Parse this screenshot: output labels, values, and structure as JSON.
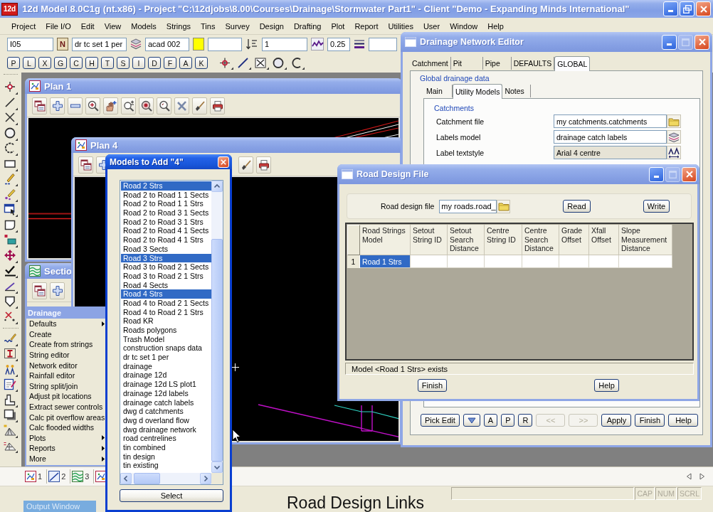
{
  "window": {
    "icon_label": "12d",
    "title": "12d Model 8.0C1g (nt.x86) - Project \"C:\\12djobs\\8.00\\Courses\\Drainage\\Stormwater Part1\" - Client \"Demo - Expanding Minds International\""
  },
  "menu_bar": [
    "Project",
    "File I/O",
    "Edit",
    "View",
    "Models",
    "Strings",
    "Tins",
    "Survey",
    "Design",
    "Drafting",
    "Plot",
    "Report",
    "Utilities",
    "User",
    "Window",
    "Help"
  ],
  "toolbar": [
    {
      "kind": "field",
      "value": "I05"
    },
    {
      "kind": "letter",
      "label": "N"
    },
    {
      "kind": "field",
      "value": "dr tc set 1 per"
    },
    {
      "kind": "icon"
    },
    {
      "kind": "field",
      "value": "acad 002"
    },
    {
      "kind": "swatch",
      "color": "#ffff00"
    },
    {
      "kind": "field"
    },
    {
      "kind": "icon"
    },
    {
      "kind": "field",
      "value": "1"
    },
    {
      "kind": "icon"
    },
    {
      "kind": "field",
      "value": "0.25"
    },
    {
      "kind": "icon"
    },
    {
      "kind": "field"
    }
  ],
  "snap_buttons": [
    "P",
    "L",
    "X",
    "G",
    "C",
    "H",
    "T",
    "S",
    "I",
    "D",
    "F",
    "A",
    "K"
  ],
  "network_editor": {
    "title": "Drainage Network Editor",
    "maximize_enabled": false,
    "tabs": [
      {
        "label": "Catchment",
        "selected": false
      },
      {
        "label": "Pit",
        "selected": false
      },
      {
        "label": "Pipe",
        "selected": false
      },
      {
        "label": "DEFAULTS",
        "selected": false
      },
      {
        "label": "GLOBAL",
        "selected": true
      }
    ],
    "group_title": "Global drainage data",
    "subtabs": [
      {
        "label": "Main",
        "selected": false
      },
      {
        "label": "Utility Models",
        "selected": true
      },
      {
        "label": "Notes",
        "selected": false
      }
    ],
    "section_title": "Catchments",
    "rows": [
      {
        "label": "Catchment file",
        "value": "my catchments.catchments",
        "kind": "file",
        "readonly": false
      },
      {
        "label": "Labels model",
        "value": "drainage catch labels",
        "kind": "model",
        "readonly": false
      },
      {
        "label": "Label textstyle",
        "value": "Arial 4 centre",
        "kind": "textstyle",
        "readonly": true
      }
    ],
    "buttons": [
      {
        "kind": "text",
        "label": "Pick Edit",
        "disabled": false
      },
      {
        "kind": "menu"
      },
      {
        "kind": "text",
        "label": "A",
        "disabled": false
      },
      {
        "kind": "text",
        "label": "P",
        "disabled": false
      },
      {
        "kind": "text",
        "label": "R",
        "disabled": false
      },
      {
        "kind": "text",
        "label": "<<",
        "disabled": true
      },
      {
        "kind": "text",
        "label": ">>",
        "disabled": true
      },
      {
        "kind": "text",
        "label": "Apply",
        "disabled": false
      },
      {
        "kind": "text",
        "label": "Finish",
        "disabled": false
      },
      {
        "kind": "text",
        "label": "Help",
        "disabled": false
      }
    ]
  },
  "views": [
    {
      "title": "Plan 1",
      "kind": "plan"
    },
    {
      "title": "Plan 4",
      "kind": "plan"
    },
    {
      "title": "Sectio",
      "kind": "section"
    }
  ],
  "models_dialog": {
    "title": "Models to Add \"4\"",
    "items": [
      {
        "label": "Road 2 Strs",
        "selected": true
      },
      {
        "label": "Road 2 to Road 1 1 Sects",
        "selected": false
      },
      {
        "label": "Road 2 to Road 1 1 Strs",
        "selected": false
      },
      {
        "label": "Road 2 to Road 3 1 Sects",
        "selected": false
      },
      {
        "label": "Road 2 to Road 3 1 Strs",
        "selected": false
      },
      {
        "label": "Road 2 to Road 4 1 Sects",
        "selected": false
      },
      {
        "label": "Road 2 to Road 4 1 Strs",
        "selected": false
      },
      {
        "label": "Road 3 Sects",
        "selected": false
      },
      {
        "label": "Road 3 Strs",
        "selected": true
      },
      {
        "label": "Road 3 to Road 2 1 Sects",
        "selected": false
      },
      {
        "label": "Road 3 to Road 2 1 Strs",
        "selected": false
      },
      {
        "label": "Road 4 Sects",
        "selected": false
      },
      {
        "label": "Road 4 Strs",
        "selected": true
      },
      {
        "label": "Road 4 to Road 2 1 Sects",
        "selected": false
      },
      {
        "label": "Road 4 to Road 2 1 Strs",
        "selected": false
      },
      {
        "label": "Road KR",
        "selected": false
      },
      {
        "label": "Roads polygons",
        "selected": false
      },
      {
        "label": "Trash Model",
        "selected": false
      },
      {
        "label": "construction snaps data",
        "selected": false
      },
      {
        "label": "dr tc set 1 per",
        "selected": false
      },
      {
        "label": "drainage",
        "selected": false
      },
      {
        "label": "drainage 12d",
        "selected": false
      },
      {
        "label": "drainage 12d LS plot1",
        "selected": false
      },
      {
        "label": "drainage 12d labels",
        "selected": false
      },
      {
        "label": "drainage catch labels",
        "selected": false
      },
      {
        "label": "dwg d catchments",
        "selected": false
      },
      {
        "label": "dwg d overland flow",
        "selected": false
      },
      {
        "label": "dwg drainage network",
        "selected": false
      },
      {
        "label": "road centrelines",
        "selected": false
      },
      {
        "label": "tin combined",
        "selected": false
      },
      {
        "label": "tin design",
        "selected": false
      },
      {
        "label": "tin existing",
        "selected": false
      }
    ],
    "button": "Select"
  },
  "road_design": {
    "title": "Road Design File",
    "maximize_enabled": false,
    "file_label": "Road design file",
    "file_value": "my roads.road_",
    "actions": [
      "Read",
      "Write"
    ],
    "columns": [
      "Road Strings Model",
      "Setout String ID",
      "Setout Search Distance",
      "Centre String ID",
      "Centre Search Distance",
      "Grade Offset",
      "Xfall Offset",
      "Slope Measurement Distance"
    ],
    "rows": [
      {
        "number": "1",
        "model": "Road 1 Strs",
        "selected": true
      }
    ],
    "message": "Model <Road 1 Strs> exists",
    "buttons": [
      "Finish",
      "Help"
    ]
  },
  "drainage_menu": {
    "title": "Drainage",
    "items": [
      {
        "label": "Defaults",
        "submenu": true
      },
      {
        "label": "Create",
        "submenu": false
      },
      {
        "label": "Create from strings",
        "submenu": false
      },
      {
        "label": "String editor",
        "submenu": false
      },
      {
        "label": "Network editor",
        "submenu": false
      },
      {
        "label": "Rainfall editor",
        "submenu": false
      },
      {
        "label": "String split/join",
        "submenu": false
      },
      {
        "label": "Adjust pit locations",
        "submenu": false
      },
      {
        "label": "Extract sewer controls",
        "submenu": false
      },
      {
        "label": "Calc pit overflow areas",
        "submenu": false
      },
      {
        "label": "Calc flooded widths",
        "submenu": false
      },
      {
        "label": "Plots",
        "submenu": true
      },
      {
        "label": "Reports",
        "submenu": true
      },
      {
        "label": "More",
        "submenu": true
      }
    ]
  },
  "view_tabs": [
    {
      "kind": "plan",
      "label": "1"
    },
    {
      "kind": "profile",
      "label": "2"
    },
    {
      "kind": "section",
      "label": "3"
    },
    {
      "kind": "plan"
    }
  ],
  "status_bar": {
    "indicators": [
      {
        "label": "CAP",
        "on": false
      },
      {
        "label": "NUM",
        "on": false
      },
      {
        "label": "SCRL",
        "on": false
      }
    ]
  },
  "output_window": "Output Window",
  "caption": "Road Design Links"
}
